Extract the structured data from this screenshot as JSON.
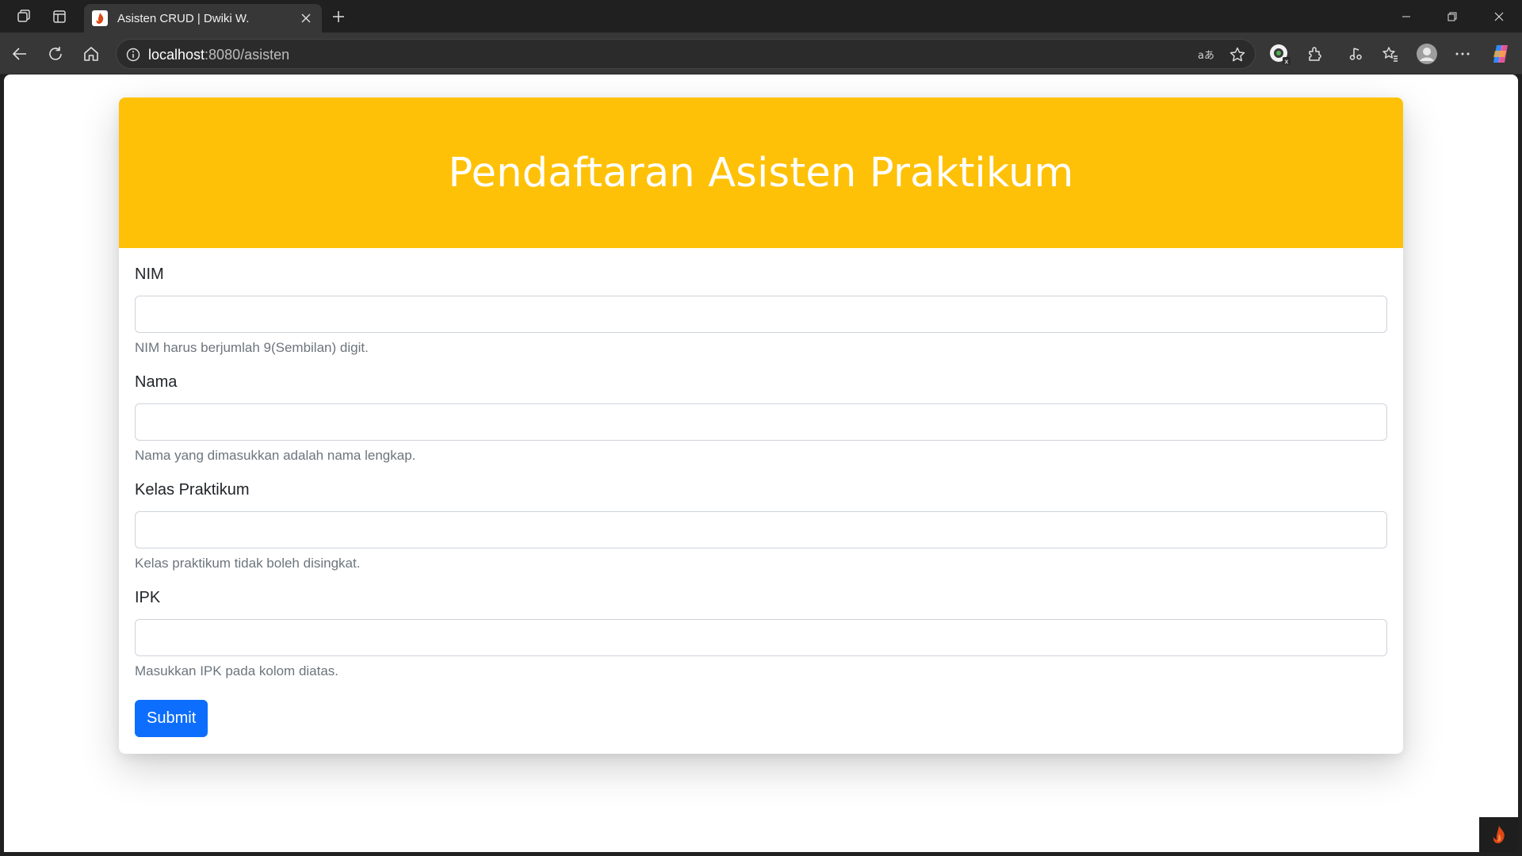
{
  "browser": {
    "tab": {
      "title": "Asisten CRUD | Dwiki W."
    },
    "address": {
      "host": "localhost",
      "rest": ":8080/asisten"
    }
  },
  "page": {
    "heading": "Pendaftaran Asisten Praktikum",
    "colors": {
      "header": "#ffc107",
      "button": "#0d6efd",
      "help": "#6c757d"
    },
    "fields": [
      {
        "label": "NIM",
        "value": "",
        "help": "NIM harus berjumlah 9(Sembilan) digit."
      },
      {
        "label": "Nama",
        "value": "",
        "help": "Nama yang dimasukkan adalah nama lengkap."
      },
      {
        "label": "Kelas Praktikum",
        "value": "",
        "help": "Kelas praktikum tidak boleh disingkat."
      },
      {
        "label": "IPK",
        "value": "",
        "help": "Masukkan IPK pada kolom diatas."
      }
    ],
    "submit_label": "Submit"
  },
  "icons": [
    "workspaces-icon",
    "vertical-tabs-icon",
    "favicon-flame-icon",
    "close-tab-icon",
    "new-tab-icon",
    "minimize-icon",
    "restore-icon",
    "close-window-icon",
    "back-icon",
    "refresh-icon",
    "home-icon",
    "info-icon",
    "read-aloud-icon",
    "favorite-star-icon",
    "extension-profile-icon",
    "extensions-icon",
    "media-icon",
    "favorites-icon",
    "profile-icon",
    "more-icon",
    "copilot-icon",
    "codeigniter-flame-icon"
  ]
}
